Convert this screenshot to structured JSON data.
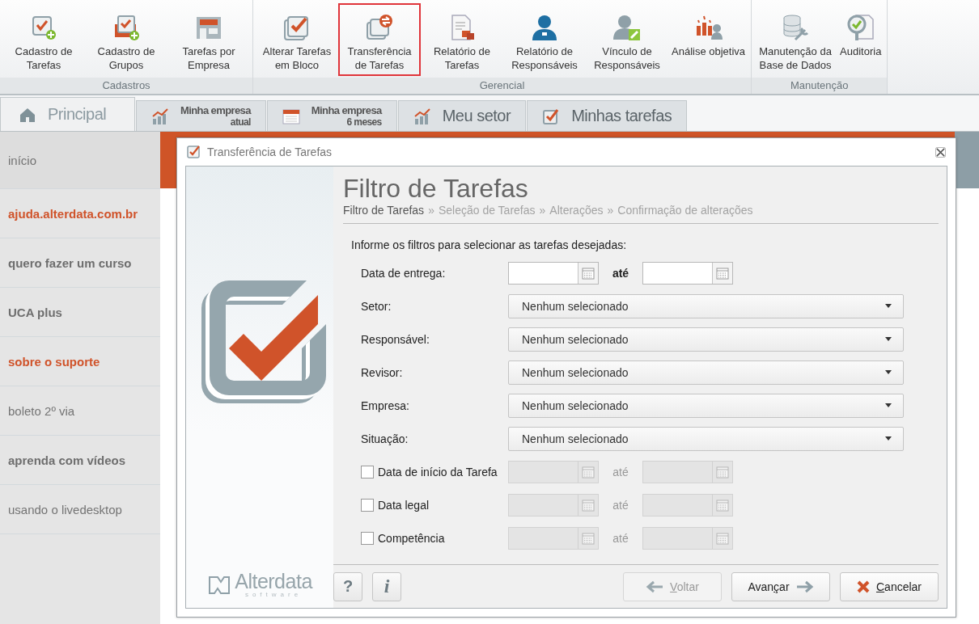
{
  "ribbon": {
    "groups": [
      {
        "label": "Cadastros",
        "buttons": [
          {
            "label": "Cadastro de Tarefas",
            "highlighted": false
          },
          {
            "label": "Cadastro de Grupos",
            "highlighted": false
          },
          {
            "label": "Tarefas por Empresa",
            "highlighted": false
          }
        ]
      },
      {
        "label": "Gerencial",
        "buttons": [
          {
            "label": "Alterar Tarefas em Bloco",
            "highlighted": false
          },
          {
            "label": "Transferência de Tarefas",
            "highlighted": true
          },
          {
            "label": "Relatório de Tarefas",
            "highlighted": false
          },
          {
            "label": "Relatório de Responsáveis",
            "highlighted": false
          },
          {
            "label": "Vínculo de Responsáveis",
            "highlighted": false
          },
          {
            "label": "Análise objetiva",
            "highlighted": false
          }
        ]
      },
      {
        "label": "Manutenção",
        "buttons": [
          {
            "label": "Manutenção da Base de Dados",
            "highlighted": false
          },
          {
            "label": "Auditoria",
            "highlighted": false
          }
        ]
      }
    ]
  },
  "tabs": [
    {
      "label": "Principal",
      "selected": true
    },
    {
      "label": "Minha empresa",
      "sublabel": "atual",
      "selected": false
    },
    {
      "label": "Minha empresa",
      "sublabel": "6 meses",
      "selected": false
    },
    {
      "label": "Meu setor",
      "selected": false
    },
    {
      "label": "Minhas tarefas",
      "selected": false
    }
  ],
  "sidebar": {
    "items": [
      {
        "label": "início",
        "kind": "plain",
        "selected": true
      },
      {
        "label": "ajuda.alterdata.com.br",
        "kind": "accent",
        "selected": false
      },
      {
        "label": "quero fazer um curso",
        "kind": "bold",
        "selected": false
      },
      {
        "label": "UCA plus",
        "kind": "bold",
        "selected": false
      },
      {
        "label": "sobre o suporte",
        "kind": "accent",
        "selected": false
      },
      {
        "label": "boleto 2º via",
        "kind": "plain",
        "selected": false
      },
      {
        "label": "aprenda com vídeos",
        "kind": "bold",
        "selected": false
      },
      {
        "label": "usando o livedesktop",
        "kind": "plain",
        "selected": false
      }
    ]
  },
  "dialog": {
    "title": "Transferência de Tarefas",
    "logo": {
      "name": "Alterdata",
      "tagline": "software"
    },
    "heading": "Filtro de Tarefas",
    "steps": [
      {
        "label": "Filtro de Tarefas",
        "selected": true
      },
      {
        "label": "Seleção de Tarefas",
        "selected": false
      },
      {
        "label": "Alterações",
        "selected": false
      },
      {
        "label": "Confirmação de alterações",
        "selected": false
      }
    ],
    "step_separator": "»",
    "instruction": "Informe os filtros para selecionar as tarefas desejadas:",
    "rows": [
      {
        "kind": "date_range",
        "label": "Data de entrega:",
        "between": "até",
        "disabled": false
      },
      {
        "kind": "select",
        "label": "Setor:",
        "value": "Nenhum selecionado"
      },
      {
        "kind": "select",
        "label": "Responsável:",
        "value": "Nenhum selecionado"
      },
      {
        "kind": "select",
        "label": "Revisor:",
        "value": "Nenhum selecionado"
      },
      {
        "kind": "select",
        "label": "Empresa:",
        "value": "Nenhum selecionado"
      },
      {
        "kind": "select",
        "label": "Situação:",
        "value": "Nenhum selecionado"
      },
      {
        "kind": "check_date_range",
        "label": "Data de início da Tarefa",
        "checked": false,
        "between": "até",
        "disabled": true
      },
      {
        "kind": "check_date_range",
        "label": "Data legal",
        "checked": false,
        "between": "até",
        "disabled": true
      },
      {
        "kind": "check_date_range",
        "label": "Competência",
        "checked": false,
        "between": "até",
        "disabled": true
      }
    ],
    "help_buttons": [
      {
        "label": "?"
      },
      {
        "label": "i"
      }
    ],
    "buttons": [
      {
        "kind": "back",
        "mnemonic": "V",
        "label_end": "oltar",
        "disabled": true
      },
      {
        "kind": "next",
        "label_start": "Avan",
        "mnemonic": "ç",
        "label_end": "ar",
        "disabled": false
      },
      {
        "kind": "cancel",
        "mnemonic": "C",
        "label_end": "ancelar",
        "disabled": false
      }
    ]
  }
}
